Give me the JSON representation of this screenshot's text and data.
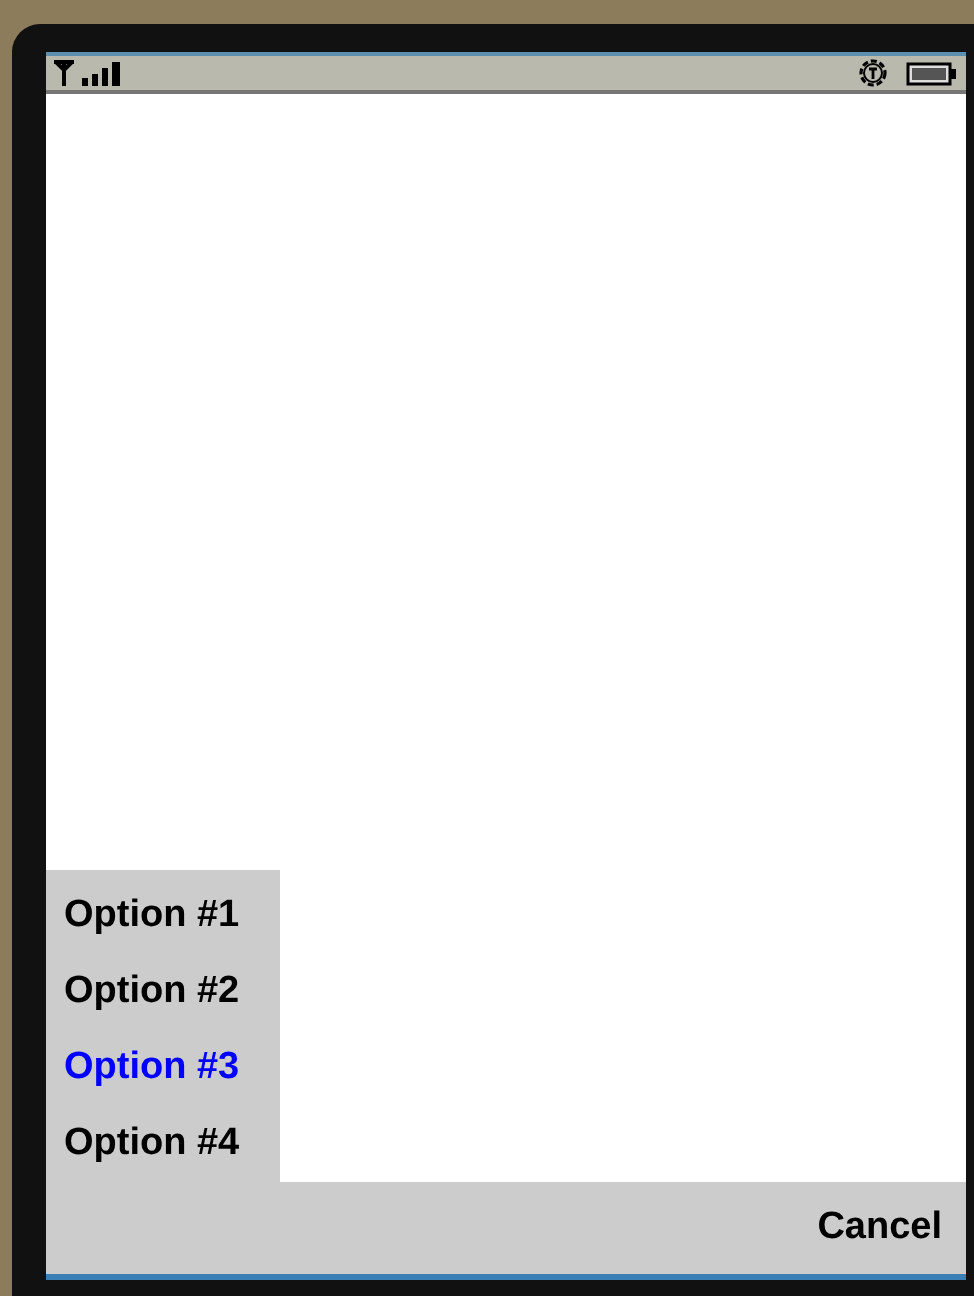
{
  "menu": {
    "items": [
      {
        "label": "Option #1",
        "selected": false
      },
      {
        "label": "Option #2",
        "selected": false
      },
      {
        "label": "Option #3",
        "selected": true
      },
      {
        "label": "Option #4",
        "selected": false
      }
    ]
  },
  "softkeys": {
    "right": "Cancel"
  }
}
